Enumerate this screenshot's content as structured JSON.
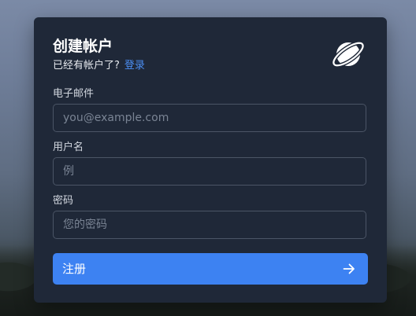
{
  "form": {
    "title": "创建帐户",
    "subtitle_text": "已经有帐户了?",
    "login_link": "登录",
    "fields": [
      {
        "label": "电子邮件",
        "placeholder": "you@example.com",
        "value": ""
      },
      {
        "label": "用户名",
        "placeholder": "例",
        "value": ""
      },
      {
        "label": "密码",
        "placeholder": "您的密码",
        "value": ""
      }
    ],
    "submit_label": "注册"
  },
  "icons": {
    "logo": "planet-icon",
    "submit": "arrow-right-icon"
  },
  "colors": {
    "card_bg": "#1f2838",
    "accent": "#3d82f2",
    "link": "#4b8ef3"
  }
}
